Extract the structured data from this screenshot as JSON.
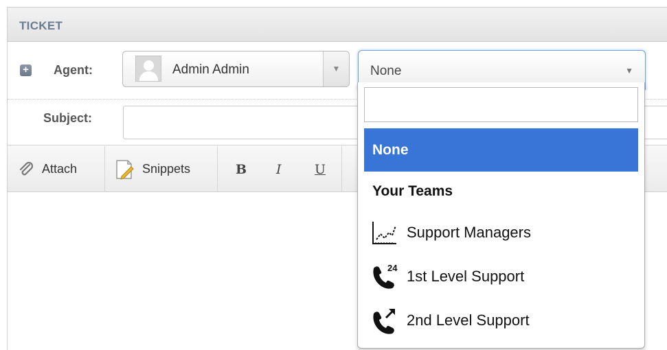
{
  "panel": {
    "title": "TICKET"
  },
  "agent": {
    "label": "Agent:",
    "selected": "Admin Admin"
  },
  "team": {
    "selected": "None",
    "search_value": "",
    "options": {
      "none": "None",
      "group_label": "Your Teams",
      "items": [
        "Support Managers",
        "1st Level Support",
        "2nd Level Support"
      ]
    }
  },
  "subject": {
    "label": "Subject:",
    "value": ""
  },
  "toolbar": {
    "attach": "Attach",
    "snippets": "Snippets",
    "bold": "B",
    "italic": "I",
    "underline": "U"
  },
  "colors": {
    "highlight": "#3875d7",
    "header_text": "#6b7b91"
  },
  "icons": {
    "expand": "plus-square-icon",
    "avatar": "user-avatar-icon",
    "search": "magnifier-icon",
    "attach": "paperclip-icon",
    "snippets": "note-pencil-icon",
    "support_managers": "line-chart-icon",
    "level1": "phone-24-icon",
    "level2": "phone-forward-icon"
  }
}
